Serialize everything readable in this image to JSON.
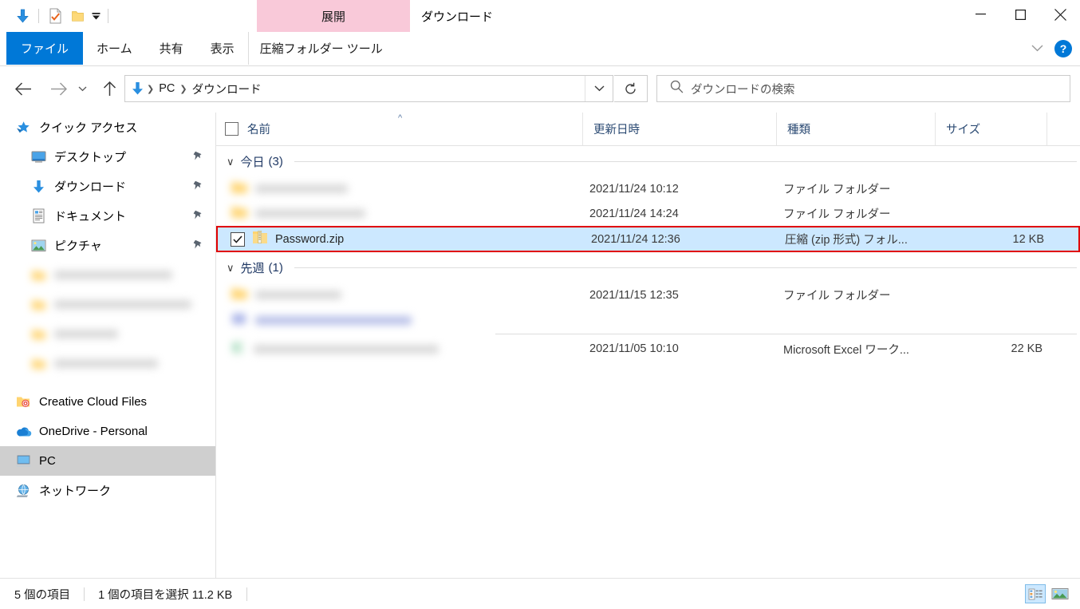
{
  "window": {
    "title": "ダウンロード",
    "minimize_label": "最小化",
    "maximize_label": "最大化",
    "close_label": "閉じる"
  },
  "quick_access_toolbar": {
    "items": [
      {
        "name": "downloads-icon",
        "label": "ダウンロード"
      },
      {
        "name": "properties-icon",
        "label": "プロパティ"
      },
      {
        "name": "new-folder-icon",
        "label": "新しいフォルダー"
      },
      {
        "name": "customize-caret-icon",
        "label": "クイック アクセス ツール バーのユーザー設定"
      }
    ]
  },
  "ribbon": {
    "contextual_tab_group": "圧縮フォルダー ツール",
    "contextual_tab": "展開",
    "tabs": [
      {
        "label": "ファイル",
        "active": true
      },
      {
        "label": "ホーム",
        "active": false
      },
      {
        "label": "共有",
        "active": false
      },
      {
        "label": "表示",
        "active": false
      }
    ],
    "expand_label": "リボンの展開",
    "help_label": "?"
  },
  "navigation": {
    "back_label": "戻る",
    "forward_label": "進む",
    "recent_label": "最近表示した場所",
    "up_label": "上へ",
    "breadcrumbs": [
      "PC",
      "ダウンロード"
    ],
    "address_dropdown_label": "以前の場所",
    "refresh_label": "ダウンロードの更新"
  },
  "search": {
    "placeholder": "ダウンロードの検索"
  },
  "sidebar": {
    "items": [
      {
        "label": "クイック アクセス",
        "icon": "star-icon",
        "level": "root",
        "pinned": false,
        "selected": false,
        "blurred": false
      },
      {
        "label": "デスクトップ",
        "icon": "desktop-icon",
        "level": "child",
        "pinned": true,
        "selected": false,
        "blurred": false
      },
      {
        "label": "ダウンロード",
        "icon": "download-icon",
        "level": "child",
        "pinned": true,
        "selected": false,
        "blurred": false
      },
      {
        "label": "ドキュメント",
        "icon": "document-icon",
        "level": "child",
        "pinned": true,
        "selected": false,
        "blurred": false
      },
      {
        "label": "ピクチャ",
        "icon": "picture-icon",
        "level": "child",
        "pinned": true,
        "selected": false,
        "blurred": false
      },
      {
        "label": "",
        "icon": "folder-icon",
        "level": "child",
        "pinned": false,
        "selected": false,
        "blurred": true
      },
      {
        "label": "",
        "icon": "folder-icon",
        "level": "child",
        "pinned": false,
        "selected": false,
        "blurred": true
      },
      {
        "label": "",
        "icon": "folder-icon",
        "level": "child",
        "pinned": false,
        "selected": false,
        "blurred": true
      },
      {
        "label": "",
        "icon": "folder-icon",
        "level": "child",
        "pinned": false,
        "selected": false,
        "blurred": true
      },
      {
        "label": "Creative Cloud Files",
        "icon": "creative-cloud-icon",
        "level": "root",
        "pinned": false,
        "selected": false,
        "blurred": false
      },
      {
        "label": "OneDrive - Personal",
        "icon": "onedrive-icon",
        "level": "root",
        "pinned": false,
        "selected": false,
        "blurred": false
      },
      {
        "label": "PC",
        "icon": "pc-icon",
        "level": "root",
        "pinned": false,
        "selected": true,
        "blurred": false
      },
      {
        "label": "ネットワーク",
        "icon": "network-icon",
        "level": "root",
        "pinned": false,
        "selected": false,
        "blurred": false
      }
    ]
  },
  "file_list": {
    "columns": [
      {
        "key": "name",
        "label": "名前",
        "sorted": true
      },
      {
        "key": "date",
        "label": "更新日時",
        "sorted": false
      },
      {
        "key": "type",
        "label": "種類",
        "sorted": false
      },
      {
        "key": "size",
        "label": "サイズ",
        "sorted": false
      }
    ],
    "groups": [
      {
        "label": "今日",
        "count": "(3)",
        "rows": [
          {
            "name": "",
            "date": "2021/11/24 10:12",
            "type": "ファイル フォルダー",
            "size": "",
            "icon": "folder-icon",
            "blurred": true,
            "selected": false,
            "highlighted": false,
            "checked": false
          },
          {
            "name": "",
            "date": "2021/11/24 14:24",
            "type": "ファイル フォルダー",
            "size": "",
            "icon": "folder-icon",
            "blurred": true,
            "selected": false,
            "highlighted": false,
            "checked": false
          },
          {
            "name": "Password.zip",
            "date": "2021/11/24 12:36",
            "type": "圧縮 (zip 形式) フォル...",
            "size": "12 KB",
            "icon": "zip-icon",
            "blurred": false,
            "selected": true,
            "highlighted": true,
            "checked": true
          }
        ]
      },
      {
        "label": "先週",
        "count": "(1)",
        "rows": [
          {
            "name": "",
            "date": "2021/11/15 12:35",
            "type": "ファイル フォルダー",
            "size": "",
            "icon": "folder-icon",
            "blurred": true,
            "selected": false,
            "highlighted": false,
            "checked": false
          },
          {
            "name": "",
            "date": "",
            "type": "",
            "size": "",
            "icon": "blue-doc-icon",
            "blurred": true,
            "selected": false,
            "highlighted": false,
            "checked": false,
            "separator_after": true
          },
          {
            "name": "",
            "date": "2021/11/05 10:10",
            "type": "Microsoft Excel ワーク...",
            "size": "22 KB",
            "icon": "excel-icon",
            "blurred": true,
            "selected": false,
            "highlighted": false,
            "checked": false
          }
        ]
      }
    ]
  },
  "status_bar": {
    "item_count": "5 個の項目",
    "selection": "1 個の項目を選択  11.2 KB",
    "details_view_label": "詳細",
    "large_icons_view_label": "大アイコン"
  },
  "colors": {
    "accent": "#0078d7",
    "selection": "#cce8ff",
    "highlight_box": "#e00000",
    "contextual_tab": "#f9c9d9",
    "sidebar_selected": "#cfcfcf",
    "folder_yellow": "#ffd470"
  }
}
